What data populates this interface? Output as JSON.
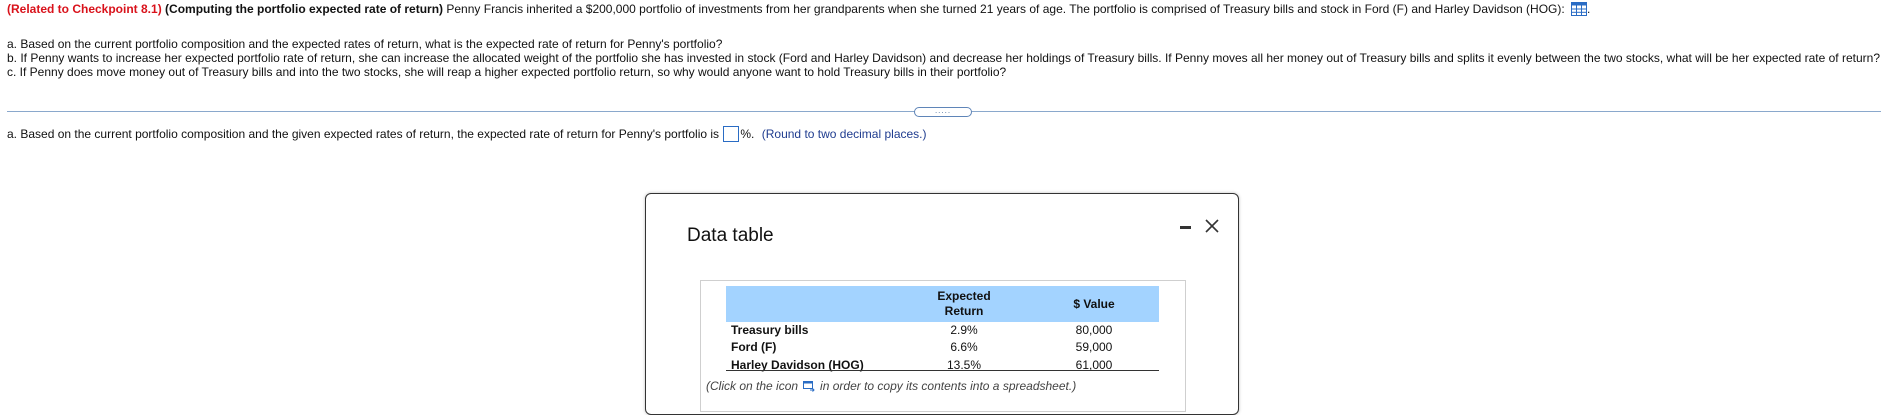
{
  "question": {
    "checkpoint_ref": "(Related to Checkpoint 8.1)",
    "topic": "(Computing the portfolio expected rate of return)",
    "intro": "Penny Francis inherited a $200,000 portfolio of investments from her grandparents when she turned 21 years of age. The portfolio is comprised of Treasury bills and stock in Ford (F) and Harley Davidson (HOG):",
    "part_a": "a. Based on the current portfolio composition and the expected rates of return, what is the expected rate of return for Penny's portfolio?",
    "part_b": "b. If Penny wants to increase her expected portfolio rate of return, she can increase the allocated weight of the portfolio she has invested in stock (Ford and Harley Davidson) and decrease her holdings of Treasury bills. If Penny moves all her money out of Treasury bills and splits it evenly between the two stocks, what will be her expected rate of return?",
    "part_c": "c. If Penny does move money out of Treasury bills and into the two stocks, she will reap a higher expected portfolio return, so why would anyone want to hold Treasury bills in their portfolio?",
    "expand_label": "....."
  },
  "answer": {
    "prompt": "a. Based on the current portfolio composition and the given expected rates of return, the expected rate of return for Penny's portfolio is",
    "value": "",
    "unit": "%.",
    "hint": "(Round to two decimal places.)"
  },
  "modal": {
    "title": "Data table",
    "table": {
      "headers": {
        "expected_return": "Expected Return",
        "value": "$ Value"
      },
      "rows": [
        {
          "name": "Treasury bills",
          "expected_return": "2.9%",
          "value": "80,000"
        },
        {
          "name": "Ford (F)",
          "expected_return": "6.6%",
          "value": "59,000"
        },
        {
          "name": "Harley Davidson (HOG)",
          "expected_return": "13.5%",
          "value": "61,000"
        }
      ]
    },
    "footnote_before": "(Click on the icon",
    "footnote_after": "in order to copy its contents into a spreadsheet.)"
  },
  "colors": {
    "accent_red": "#d9121b",
    "header_blue": "#a3d3ff",
    "link_blue": "#1f3c8f"
  }
}
